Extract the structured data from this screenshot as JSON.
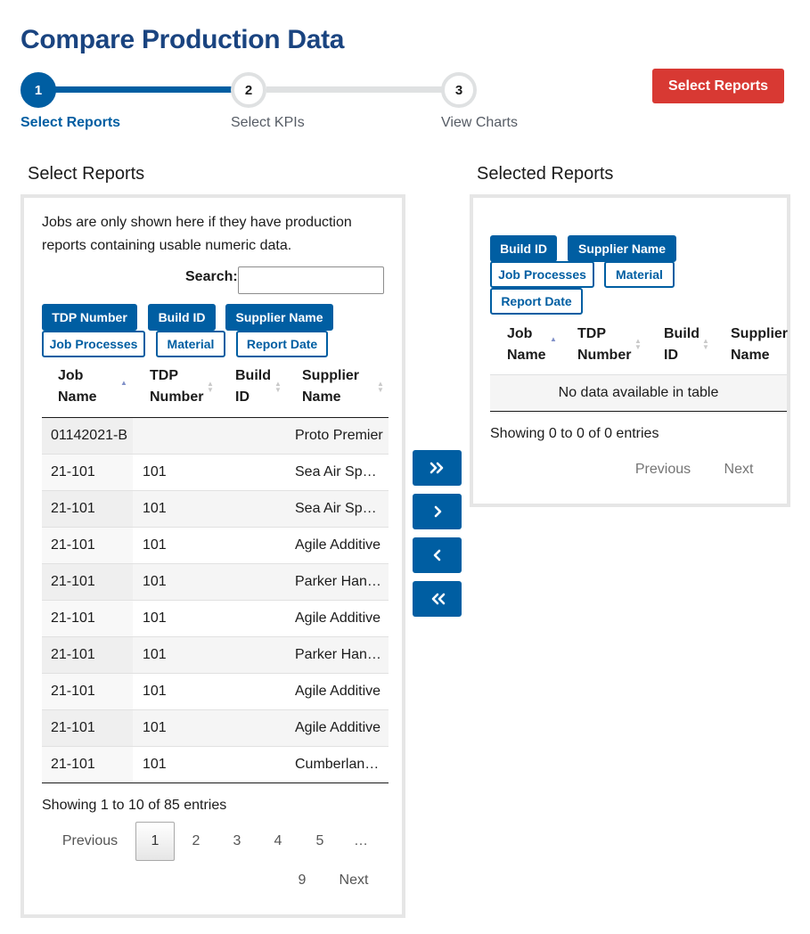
{
  "page": {
    "title": "Compare Production Data"
  },
  "stepper": {
    "steps": [
      {
        "number": "1",
        "label": "Select Reports"
      },
      {
        "number": "2",
        "label": "Select KPIs"
      },
      {
        "number": "3",
        "label": "View Charts"
      }
    ],
    "current_step": 1
  },
  "header": {
    "select_reports_button": "Select Reports"
  },
  "left": {
    "section_title": "Select Reports",
    "note": "Jobs are only shown here if they have production reports containing usable numeric data.",
    "search": {
      "label": "Search:",
      "value": "",
      "placeholder": ""
    },
    "column_chips": [
      {
        "label": "TDP Number",
        "active": true
      },
      {
        "label": "Build ID",
        "active": true
      },
      {
        "label": "Supplier Name",
        "active": true
      },
      {
        "label": "Job Processes",
        "active": false
      },
      {
        "label": "Material",
        "active": false
      },
      {
        "label": "Report Date",
        "active": false
      }
    ],
    "table": {
      "headers": [
        {
          "line1": "Job",
          "line2": "Name"
        },
        {
          "line1": "TDP",
          "line2": "Number"
        },
        {
          "line1": "Build",
          "line2": "ID"
        },
        {
          "line1": "Supplier",
          "line2": "Name"
        }
      ],
      "rows": [
        {
          "job_name": "01142021-B",
          "tdp_number": "",
          "build_id": "",
          "supplier_name": "Proto Premier"
        },
        {
          "job_name": "21-101",
          "tdp_number": "101",
          "build_id": "",
          "supplier_name": "Sea Air Space"
        },
        {
          "job_name": "21-101",
          "tdp_number": "101",
          "build_id": "",
          "supplier_name": "Sea Air Space"
        },
        {
          "job_name": "21-101",
          "tdp_number": "101",
          "build_id": "",
          "supplier_name": "Agile Additive"
        },
        {
          "job_name": "21-101",
          "tdp_number": "101",
          "build_id": "",
          "supplier_name": "Parker Hannifin"
        },
        {
          "job_name": "21-101",
          "tdp_number": "101",
          "build_id": "",
          "supplier_name": "Agile Additive"
        },
        {
          "job_name": "21-101",
          "tdp_number": "101",
          "build_id": "",
          "supplier_name": "Parker Hannifin"
        },
        {
          "job_name": "21-101",
          "tdp_number": "101",
          "build_id": "",
          "supplier_name": "Agile Additive"
        },
        {
          "job_name": "21-101",
          "tdp_number": "101",
          "build_id": "",
          "supplier_name": "Agile Additive"
        },
        {
          "job_name": "21-101",
          "tdp_number": "101",
          "build_id": "",
          "supplier_name": "Cumberland Additive"
        }
      ]
    },
    "info": "Showing 1 to 10 of 85 entries",
    "pagination": {
      "previous": "Previous",
      "pages": [
        "1",
        "2",
        "3",
        "4",
        "5",
        "…",
        "9"
      ],
      "current": "1",
      "next": "Next"
    }
  },
  "transfer": {
    "move_all_right_icon": "double-chevron-right-icon",
    "move_right_icon": "chevron-right-icon",
    "move_left_icon": "chevron-left-icon",
    "move_all_left_icon": "double-chevron-left-icon"
  },
  "right": {
    "section_title": "Selected Reports",
    "column_chips": [
      {
        "label": "Build ID",
        "active": true
      },
      {
        "label": "Supplier Name",
        "active": true
      },
      {
        "label": "Job Processes",
        "active": false
      },
      {
        "label": "Material",
        "active": false
      },
      {
        "label": "Report Date",
        "active": false
      }
    ],
    "table": {
      "headers": [
        {
          "line1": "Job",
          "line2": "Name"
        },
        {
          "line1": "TDP",
          "line2": "Number"
        },
        {
          "line1": "Build",
          "line2": "ID"
        },
        {
          "line1": "Supplier",
          "line2": "Name"
        }
      ],
      "empty_message": "No data available in table"
    },
    "info": "Showing 0 to 0 of 0 entries",
    "pagination": {
      "previous": "Previous",
      "next": "Next"
    }
  },
  "colors": {
    "primary": "#005ea2",
    "title": "#1a4480",
    "danger": "#d83933",
    "panel_border": "#e6e6e6",
    "step_inactive": "#dfe1e2"
  }
}
